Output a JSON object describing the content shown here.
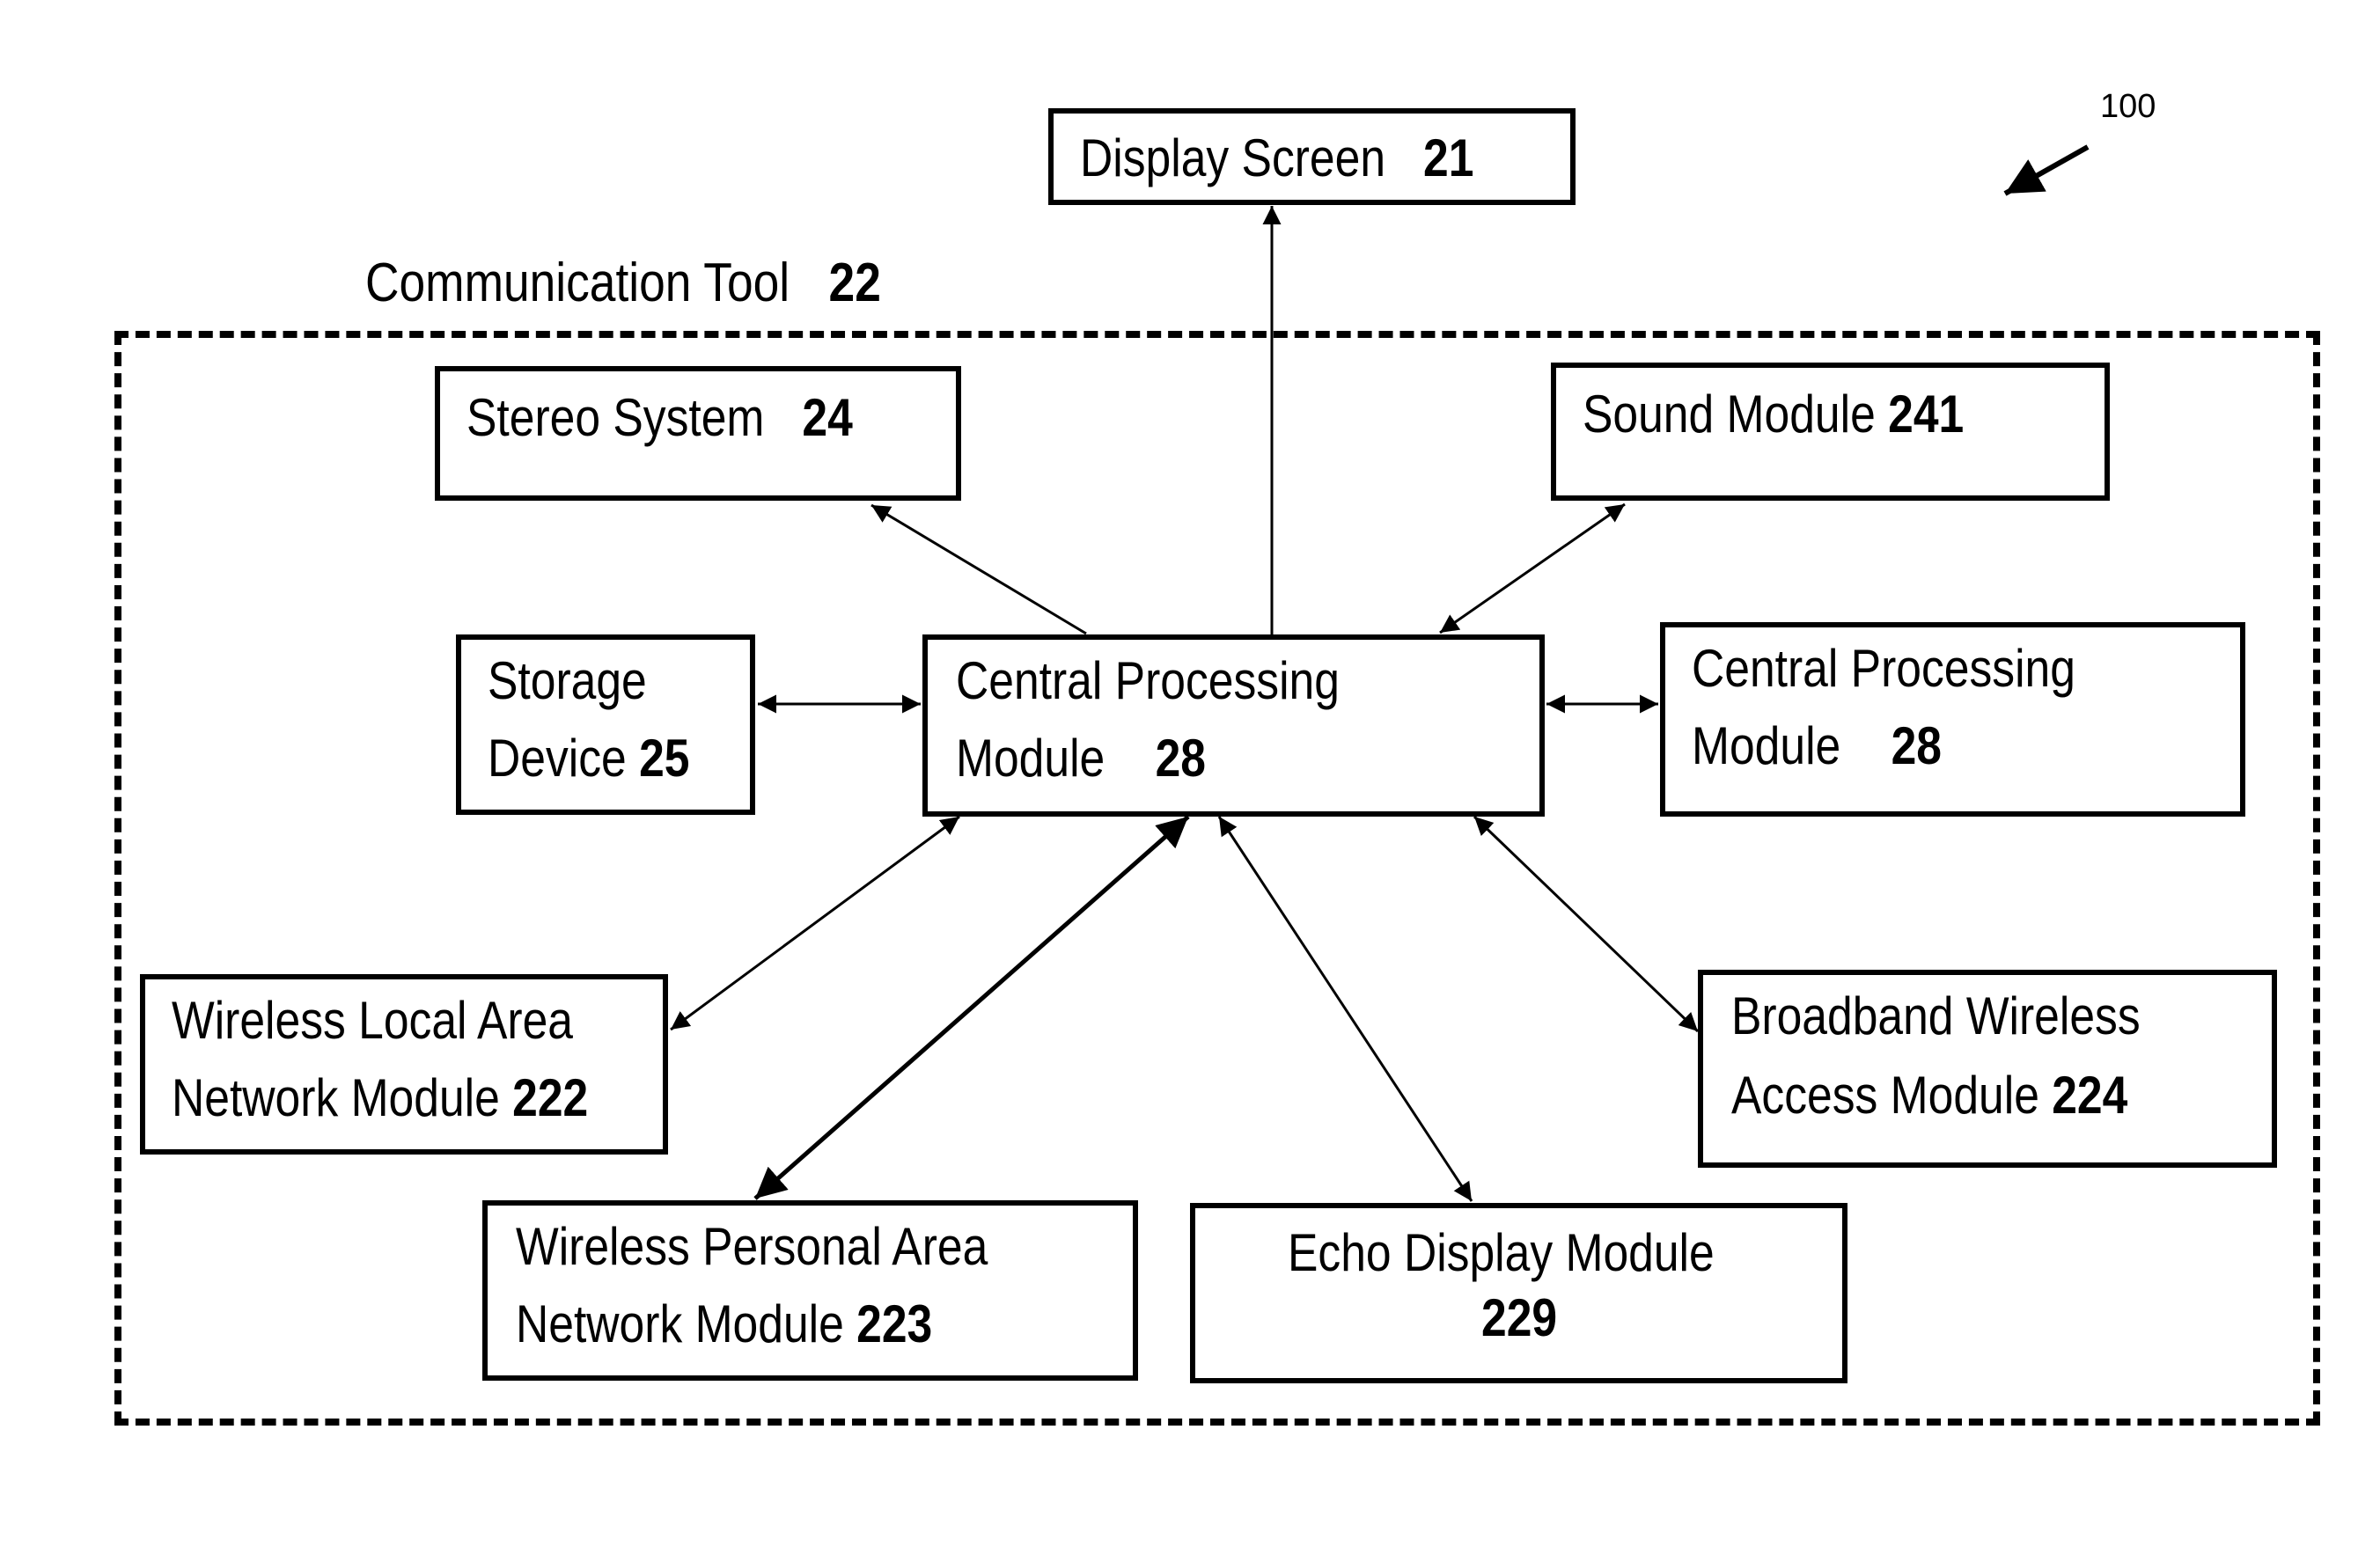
{
  "figure_ref": "100",
  "container": {
    "label": "Communication Tool",
    "number": "22"
  },
  "nodes": {
    "display_screen": {
      "label": "Display Screen",
      "number": "21"
    },
    "stereo_system": {
      "label": "Stereo System",
      "number": "24"
    },
    "sound_module": {
      "label": "Sound Module",
      "number": "241"
    },
    "storage_device": {
      "line1": "Storage",
      "line2": "Device",
      "number": "25"
    },
    "cpm_center": {
      "line1": "Central Processing",
      "line2": "Module",
      "number": "28"
    },
    "cpm_right": {
      "line1": "Central Processing",
      "line2": "Module",
      "number": "28"
    },
    "wlan": {
      "line1": "Wireless Local Area",
      "line2": "Network Module",
      "number": "222"
    },
    "bwa": {
      "line1": "Broadband Wireless",
      "line2": "Access Module",
      "number": "224"
    },
    "wpan": {
      "line1": "Wireless Personal Area",
      "line2": "Network Module",
      "number": "223"
    },
    "echo": {
      "line1": "Echo Display  Module",
      "number": "229"
    }
  },
  "connections": [
    {
      "from": "cpm_center",
      "to": "display_screen",
      "type": "one-way"
    },
    {
      "from": "cpm_center",
      "to": "stereo_system",
      "type": "one-way"
    },
    {
      "from": "cpm_center",
      "to": "sound_module",
      "type": "two-way"
    },
    {
      "from": "cpm_center",
      "to": "storage_device",
      "type": "two-way"
    },
    {
      "from": "cpm_center",
      "to": "cpm_right",
      "type": "two-way"
    },
    {
      "from": "cpm_center",
      "to": "wlan",
      "type": "two-way"
    },
    {
      "from": "cpm_center",
      "to": "wpan",
      "type": "two-way"
    },
    {
      "from": "cpm_center",
      "to": "echo",
      "type": "two-way"
    },
    {
      "from": "cpm_center",
      "to": "bwa",
      "type": "two-way"
    }
  ]
}
